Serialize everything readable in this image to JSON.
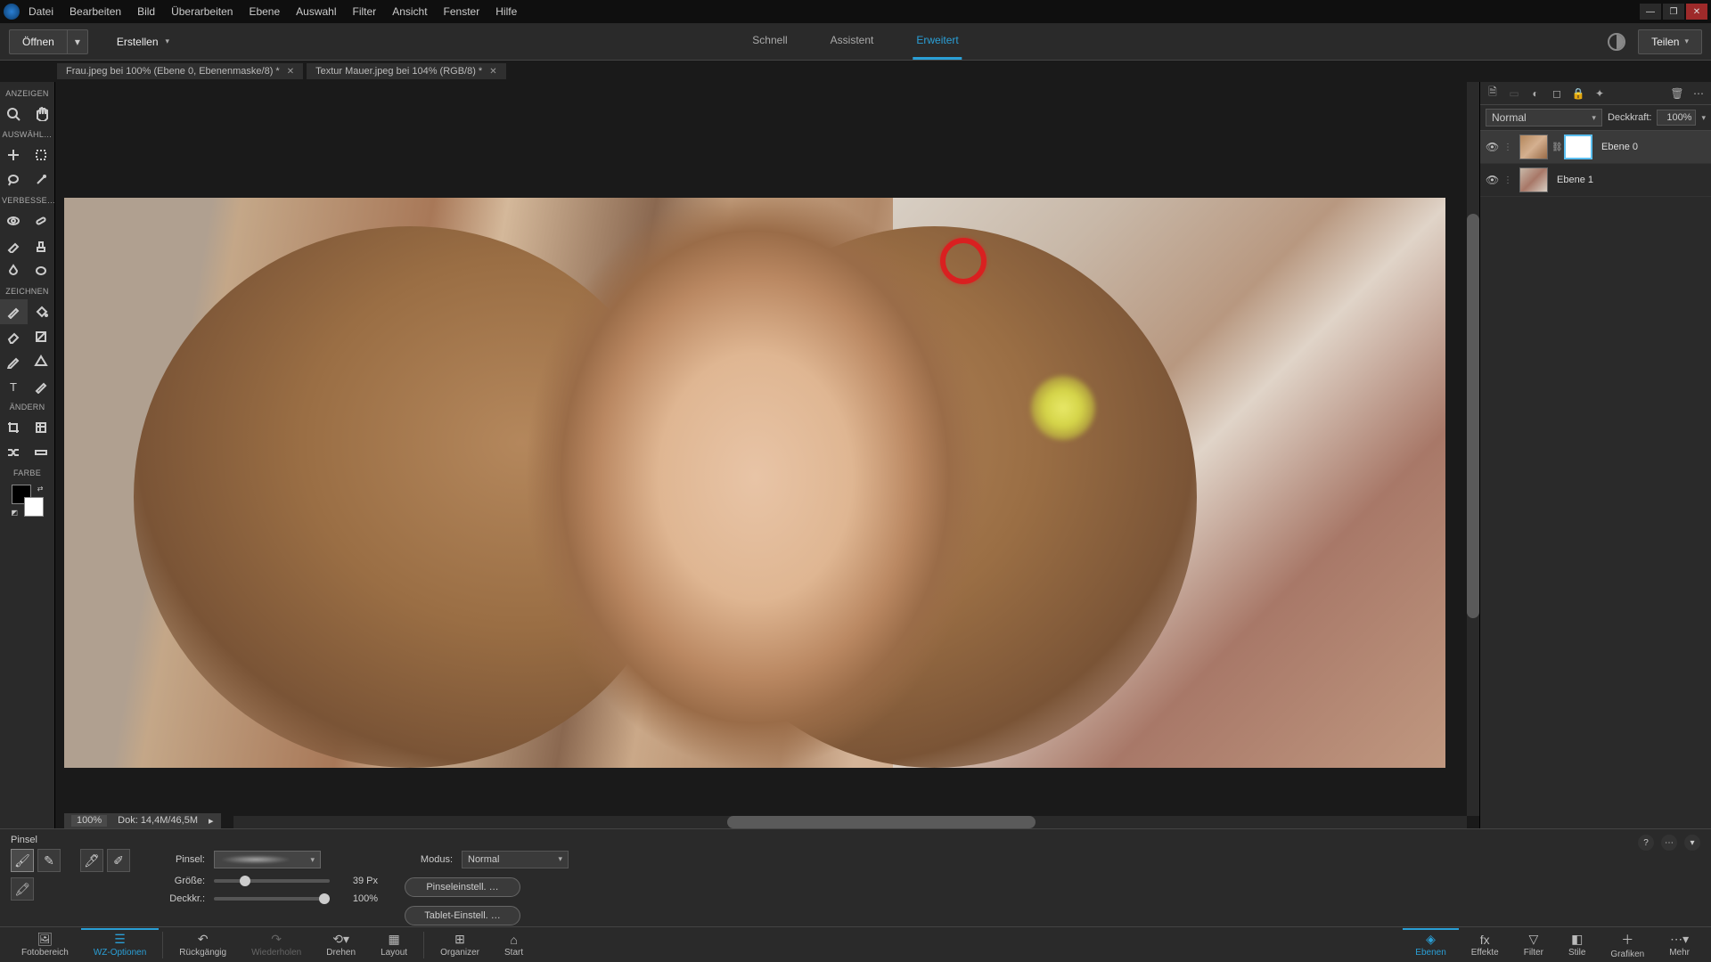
{
  "menu": {
    "datei": "Datei",
    "bearbeiten": "Bearbeiten",
    "bild": "Bild",
    "ueberarbeiten": "Überarbeiten",
    "ebene": "Ebene",
    "auswahl": "Auswahl",
    "filter": "Filter",
    "ansicht": "Ansicht",
    "fenster": "Fenster",
    "hilfe": "Hilfe"
  },
  "topbar": {
    "open": "Öffnen",
    "create": "Erstellen",
    "share": "Teilen"
  },
  "tabs": {
    "quick": "Schnell",
    "assistant": "Assistent",
    "advanced": "Erweitert"
  },
  "docTabs": [
    {
      "title": "Frau.jpeg bei 100% (Ebene 0, Ebenenmaske/8) *"
    },
    {
      "title": "Textur Mauer.jpeg bei 104% (RGB/8) *"
    }
  ],
  "toolSections": {
    "anzeigen": "ANZEIGEN",
    "auswaehlen": "AUSWÄHL…",
    "verbessern": "VERBESSE…",
    "zeichnen": "ZEICHNEN",
    "aendern": "ÄNDERN",
    "farbe": "FARBE"
  },
  "zoom": {
    "pct": "100%",
    "doc": "Dok: 14,4M/46,5M"
  },
  "layersPanel": {
    "blendMode": "Normal",
    "opacityLabel": "Deckkraft:",
    "opacityValue": "100%",
    "layers": [
      {
        "name": "Ebene 0",
        "hasMask": true
      },
      {
        "name": "Ebene 1",
        "hasMask": false
      }
    ]
  },
  "brushOptions": {
    "title": "Pinsel",
    "brushLabel": "Pinsel:",
    "sizeLabel": "Größe:",
    "sizeValue": "39 Px",
    "sizePct": 22,
    "opacityLabel": "Deckkr.:",
    "opacityValue": "100%",
    "opacityPct": 100,
    "modeLabel": "Modus:",
    "modeValue": "Normal",
    "brushSettings": "Pinseleinstell. …",
    "tabletSettings": "Tablet-Einstell. …"
  },
  "bottomBar": {
    "fotobereich": "Fotobereich",
    "wzoptionen": "WZ-Optionen",
    "rueckgaengig": "Rückgängig",
    "wiederholen": "Wiederholen",
    "drehen": "Drehen",
    "layout": "Layout",
    "organizer": "Organizer",
    "start": "Start",
    "ebenen": "Ebenen",
    "effekte": "Effekte",
    "filter": "Filter",
    "stile": "Stile",
    "grafiken": "Grafiken",
    "mehr": "Mehr"
  }
}
